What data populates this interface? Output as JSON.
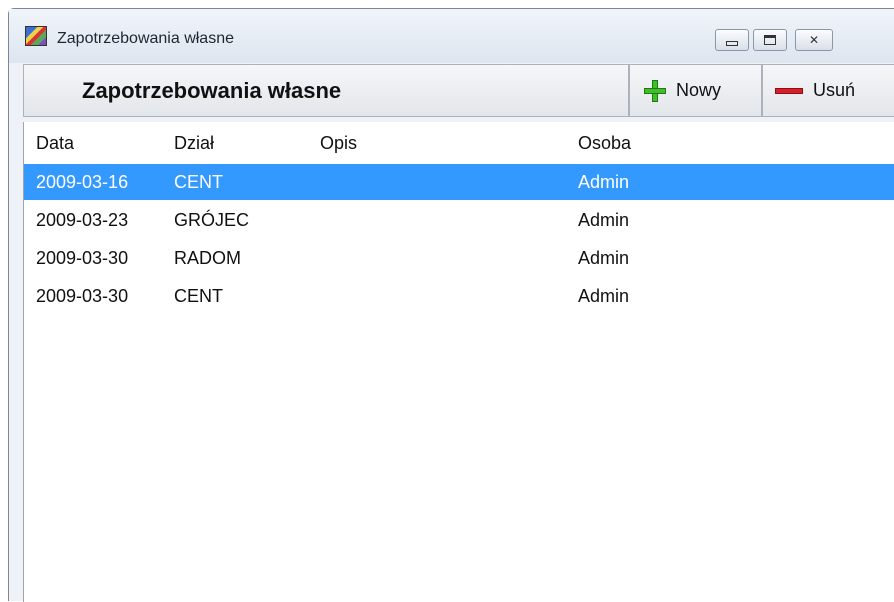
{
  "window": {
    "title": "Zapotrzebowania własne",
    "icon": "app-icon"
  },
  "toolbar": {
    "title": "Zapotrzebowania własne",
    "new_label": "Nowy",
    "new_icon": "plus-icon",
    "delete_label": "Usuń",
    "delete_icon": "minus-icon"
  },
  "table": {
    "headers": [
      "Data",
      "Dział",
      "Opis",
      "Osoba"
    ],
    "rows": [
      {
        "date": "2009-03-16",
        "dept": "CENT",
        "desc": "",
        "person": "Admin",
        "selected": true
      },
      {
        "date": "2009-03-23",
        "dept": "GRÓJEC",
        "desc": "",
        "person": "Admin",
        "selected": false
      },
      {
        "date": "2009-03-30",
        "dept": "RADOM",
        "desc": "",
        "person": "Admin",
        "selected": false
      },
      {
        "date": "2009-03-30",
        "dept": "CENT",
        "desc": "",
        "person": "Admin",
        "selected": false
      }
    ]
  },
  "colors": {
    "selection": "#3399ff",
    "add_icon": "#3fbf2a",
    "delete_icon": "#d81e2a"
  }
}
